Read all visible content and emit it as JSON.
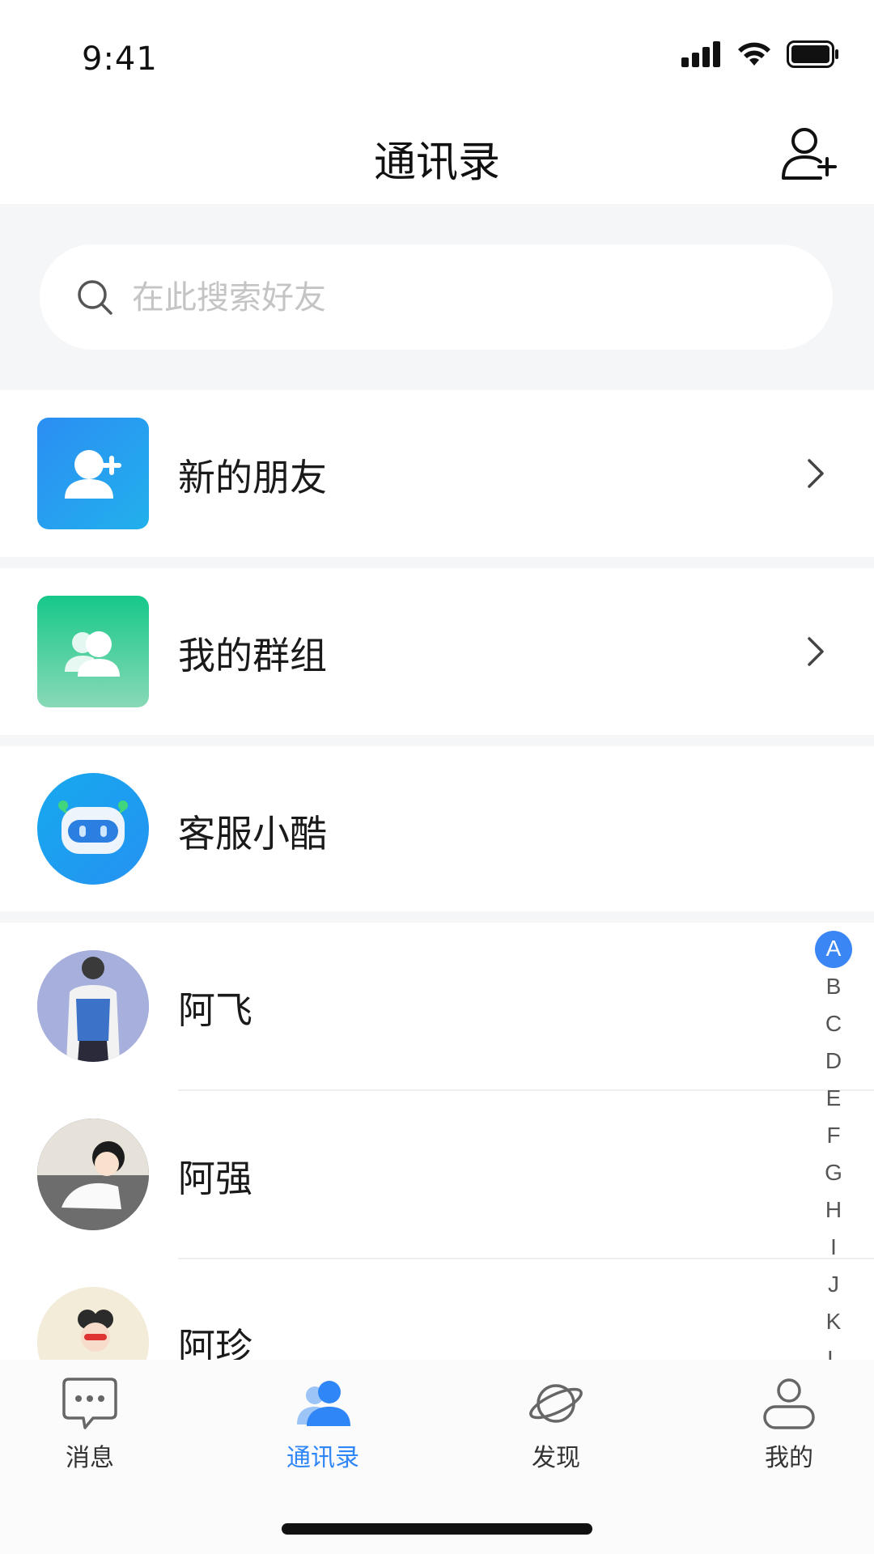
{
  "status_bar": {
    "time": "9:41"
  },
  "header": {
    "title": "通讯录",
    "add_friend_icon": "add-user-icon"
  },
  "search": {
    "placeholder": "在此搜索好友",
    "value": ""
  },
  "entries": [
    {
      "label": "新的朋友",
      "icon": "add-user-icon",
      "color": "#2a9af0"
    },
    {
      "label": "我的群组",
      "icon": "group-icon",
      "color": "#22c58f"
    },
    {
      "label": "客服小酷",
      "icon": "robot-icon",
      "color": "#1e9cf0"
    }
  ],
  "contacts": [
    {
      "name": "阿飞"
    },
    {
      "name": "阿强"
    },
    {
      "name": "阿珍"
    }
  ],
  "index_letters": [
    "A",
    "B",
    "C",
    "D",
    "E",
    "F",
    "G",
    "H",
    "I",
    "J",
    "K",
    "L"
  ],
  "index_active": "A",
  "tabs": [
    {
      "label": "消息",
      "icon": "message-icon",
      "active": false
    },
    {
      "label": "通讯录",
      "icon": "contacts-icon",
      "active": true
    },
    {
      "label": "发现",
      "icon": "discover-planet-icon",
      "active": false
    },
    {
      "label": "我的",
      "icon": "profile-icon",
      "active": false
    }
  ],
  "colors": {
    "accent": "#2f86f6",
    "index_active": "#3b86f5"
  }
}
